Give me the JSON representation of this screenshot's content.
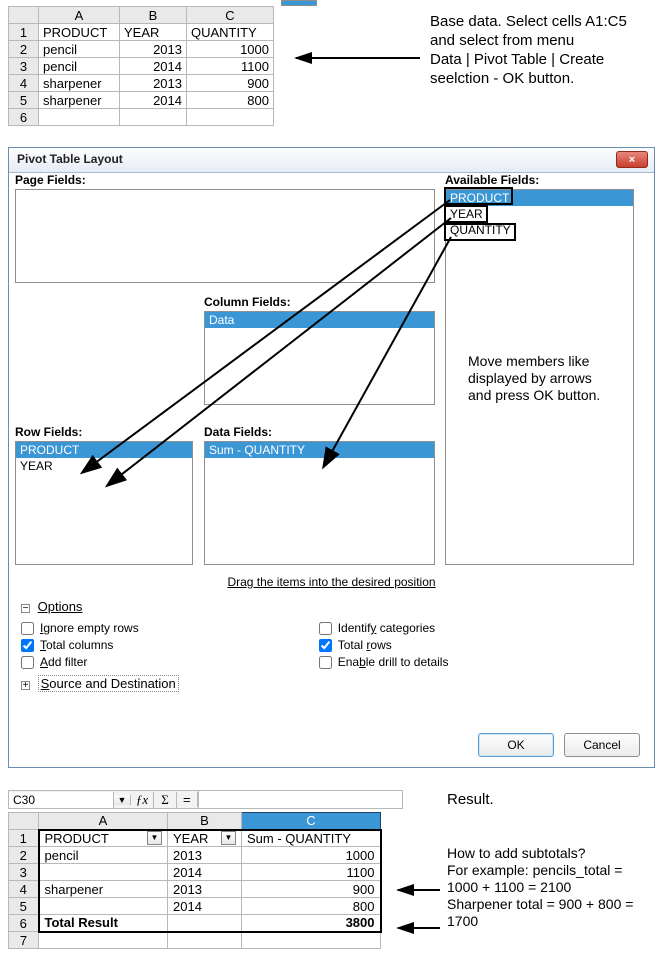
{
  "top_sheet": {
    "cols": [
      "A",
      "B",
      "C"
    ],
    "header": {
      "c0": "PRODUCT",
      "c1": "YEAR",
      "c2": "QUANTITY"
    },
    "rows": [
      {
        "c0": "pencil",
        "c1": "2013",
        "c2": "1000"
      },
      {
        "c0": "pencil",
        "c1": "2014",
        "c2": "1100"
      },
      {
        "c0": "sharpener",
        "c1": "2013",
        "c2": "900"
      },
      {
        "c0": "sharpener",
        "c1": "2014",
        "c2": "800"
      }
    ],
    "rownums": [
      "1",
      "2",
      "3",
      "4",
      "5",
      "6"
    ]
  },
  "instr1": "Base data. Select cells A1:C5 and select from menu\nData | Pivot Table | Create seelction -  OK button.",
  "dialog": {
    "title": "Pivot Table Layout",
    "close_label": "×",
    "labels": {
      "page": "Page Fields:",
      "avail": "Available Fields:",
      "colf": "Column Fields:",
      "rowf": "Row Fields:",
      "dataf": "Data Fields:"
    },
    "avail_items": [
      "PRODUCT",
      "YEAR",
      "QUANTITY"
    ],
    "col_items": [
      "Data"
    ],
    "row_items": [
      "PRODUCT",
      "YEAR"
    ],
    "data_items": [
      "Sum - QUANTITY"
    ],
    "hint": "Drag the items into the desired position",
    "options_label": "Options",
    "src_label": "Source and Destination",
    "opts": {
      "ignore": "Ignore empty rows",
      "totalcols": "Total columns",
      "addfilter": "Add filter",
      "identify": "Identify categories",
      "totalrows": "Total rows",
      "enable": "Enable drill to details"
    },
    "ok": "OK",
    "cancel": "Cancel"
  },
  "instr2": "Move members like displayed by arrows and press OK button.",
  "result_label": "Result.",
  "instr3": "How to add subtotals?\nFor example: pencils_total = 1000 + 1100 = 2100\nSharpener total = 900 + 800 = 1700",
  "formula_bar": {
    "cell_ref": "C30",
    "fx": "ƒx",
    "sigma": "Σ",
    "eq": "="
  },
  "result_sheet": {
    "cols": [
      "A",
      "B",
      "C"
    ],
    "header": {
      "c0": "PRODUCT",
      "c1": "YEAR",
      "c2": "Sum - QUANTITY"
    },
    "rows": [
      {
        "c0": "pencil",
        "c1": "2013",
        "c2": "1000"
      },
      {
        "c0": "",
        "c1": "2014",
        "c2": "1100"
      },
      {
        "c0": "sharpener",
        "c1": "2013",
        "c2": "900"
      },
      {
        "c0": "",
        "c1": "2014",
        "c2": "800"
      }
    ],
    "total_label": "Total Result",
    "total_val": "3800",
    "rownums": [
      "1",
      "2",
      "3",
      "4",
      "5",
      "6",
      "7"
    ]
  }
}
